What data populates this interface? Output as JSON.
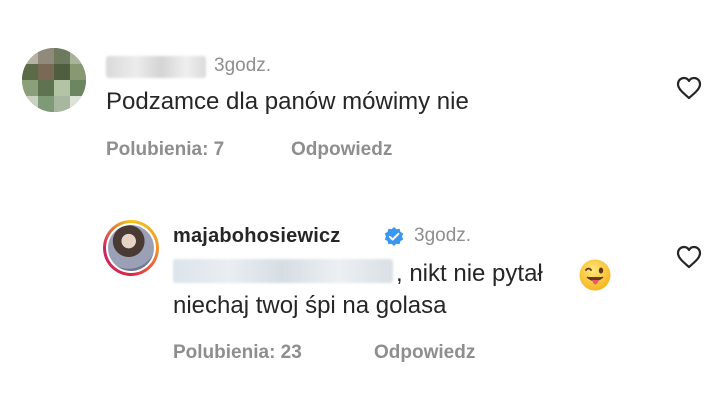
{
  "comments": [
    {
      "username": "",
      "time": "3godz.",
      "text": "Podzamce dla panów mówimy nie",
      "likes_label": "Polubienia: 7",
      "reply_label": "Odpowiedz"
    }
  ],
  "reply": {
    "username": "majabohosiewicz",
    "verified": true,
    "time": "3godz.",
    "text_line1": ", nikt nie pytał",
    "emoji": "winking-face-with-tongue",
    "text_line2": "niechaj twoj śpi na golasa",
    "likes_label": "Polubienia: 23",
    "reply_label": "Odpowiedz"
  },
  "icons": {
    "like": "heart-outline-icon",
    "verified": "verified-badge-icon"
  },
  "colors": {
    "text": "#262626",
    "secondary": "#8e8e8e",
    "verified": "#3897f0"
  }
}
